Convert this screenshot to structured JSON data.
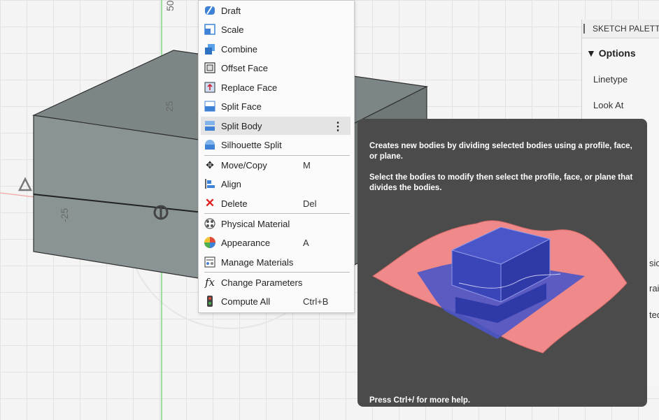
{
  "viewport": {
    "dimension_labels": {
      "top": "50",
      "left_upper": "25",
      "left_lower": "-25"
    }
  },
  "menu": {
    "items": [
      {
        "label": "Draft",
        "icon": "draft-icon",
        "shortcut": ""
      },
      {
        "label": "Scale",
        "icon": "scale-icon",
        "shortcut": ""
      },
      {
        "label": "Combine",
        "icon": "combine-icon",
        "shortcut": ""
      },
      {
        "label": "Offset Face",
        "icon": "offset-face-icon",
        "shortcut": ""
      },
      {
        "label": "Replace Face",
        "icon": "replace-face-icon",
        "shortcut": ""
      },
      {
        "label": "Split Face",
        "icon": "split-face-icon",
        "shortcut": ""
      },
      {
        "label": "Split Body",
        "icon": "split-body-icon",
        "shortcut": "",
        "highlighted": true
      },
      {
        "label": "Silhouette Split",
        "icon": "silhouette-split-icon",
        "shortcut": ""
      },
      {
        "label": "Move/Copy",
        "icon": "move-icon",
        "shortcut": "M"
      },
      {
        "label": "Align",
        "icon": "align-icon",
        "shortcut": ""
      },
      {
        "label": "Delete",
        "icon": "delete-icon",
        "shortcut": "Del"
      },
      {
        "label": "Physical Material",
        "icon": "physical-material-icon",
        "shortcut": ""
      },
      {
        "label": "Appearance",
        "icon": "appearance-icon",
        "shortcut": "A"
      },
      {
        "label": "Manage Materials",
        "icon": "manage-materials-icon",
        "shortcut": ""
      },
      {
        "label": "Change Parameters",
        "icon": "fx-icon",
        "shortcut": ""
      },
      {
        "label": "Compute All",
        "icon": "compute-all-icon",
        "shortcut": "Ctrl+B"
      }
    ]
  },
  "panel": {
    "title": "SKETCH PALETTE",
    "section": "Options",
    "rows": [
      "Linetype",
      "Look At"
    ],
    "cut_off_rows": [
      "sio",
      "rain",
      "ted"
    ]
  },
  "tooltip": {
    "description": "Creates new bodies by dividing selected bodies using a profile, face, or plane.",
    "instruction": "Select the bodies to modify then select the profile, face, or plane that divides the bodies.",
    "help": "Press Ctrl+/ for more help.",
    "colors": {
      "background": "#4b4b4b",
      "surface": "#f08a8a",
      "body": "#4a55c8"
    }
  }
}
